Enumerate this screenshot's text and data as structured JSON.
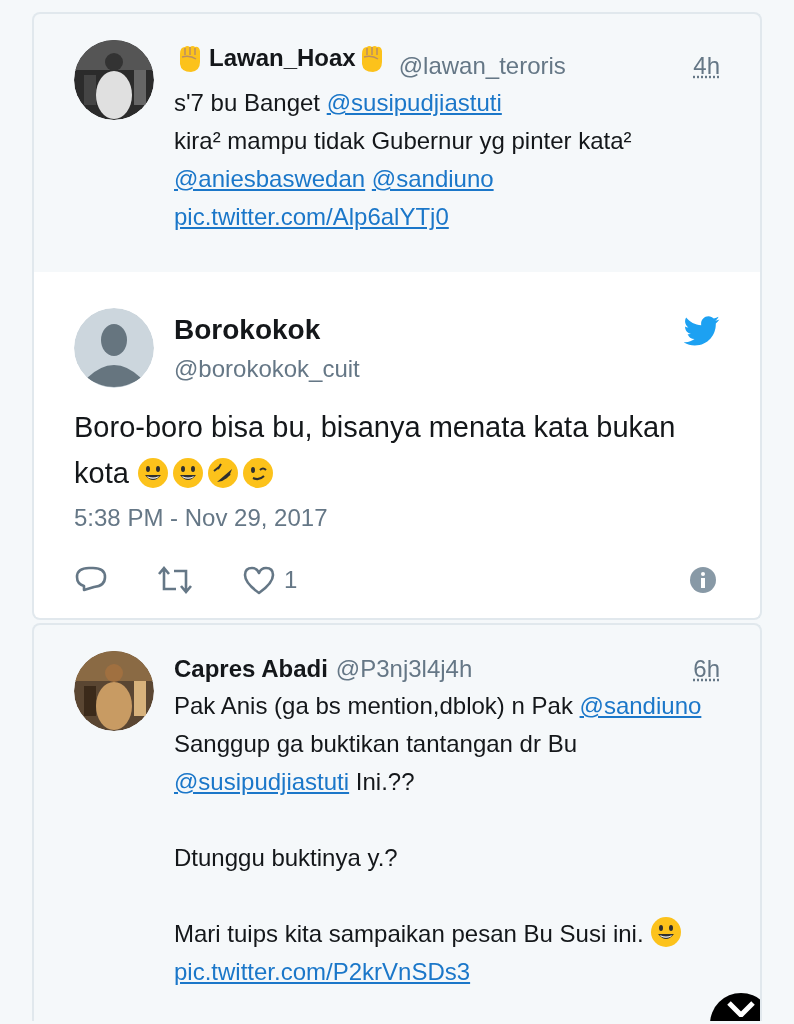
{
  "tweets": [
    {
      "kind": "reply",
      "name_parts": [
        {
          "kind": "fist"
        },
        {
          "kind": "text",
          "text": "Lawan_Hoax"
        },
        {
          "kind": "fist"
        }
      ],
      "handle": "@lawan_teroris",
      "time": "4h",
      "paragraphs": [
        [
          [
            {
              "kind": "text",
              "text": "s'7 bu Banget "
            },
            {
              "kind": "link",
              "text": "@susipudjiastuti"
            }
          ],
          [
            {
              "kind": "text",
              "text": "kira² mampu tidak Gubernur yg pinter kata²"
            }
          ],
          [
            {
              "kind": "link",
              "text": "@aniesbaswedan"
            },
            {
              "kind": "link",
              "text": "@sandiuno"
            }
          ],
          [
            {
              "kind": "link",
              "text": "pic.twitter.com/Alp6alYTj0"
            }
          ]
        ]
      ]
    },
    {
      "kind": "main",
      "name": "Borokokok",
      "handle": "@borokokok_cuit",
      "paragraphs": [
        [
          [
            {
              "kind": "text",
              "text": "Boro-boro bisa bu, bisanya menata kata bukan kota "
            },
            {
              "kind": "smile"
            },
            {
              "kind": "smile"
            },
            {
              "kind": "laugh"
            },
            {
              "kind": "wink"
            }
          ]
        ]
      ],
      "timestamp": "5:38 PM - Nov 29, 2017",
      "like_count": "1"
    },
    {
      "kind": "reply",
      "name_parts": [
        {
          "kind": "text",
          "text": "Capres Abadi"
        }
      ],
      "handle": "@P3nj3l4j4h",
      "time": "6h",
      "paragraphs": [
        [
          [
            {
              "kind": "text",
              "text": "Pak Anis (ga bs mention,dblok) n Pak "
            },
            {
              "kind": "link",
              "text": "@sandiuno"
            },
            {
              "kind": "text",
              "text": " Sanggup ga buktikan tantangan dr Bu "
            },
            {
              "kind": "link",
              "text": "@susipudjiastuti"
            },
            {
              "kind": "text",
              "text": " Ini.??"
            }
          ]
        ],
        [
          [
            {
              "kind": "text",
              "text": "Dtunggu buktinya y.?"
            }
          ]
        ],
        [
          [
            {
              "kind": "text",
              "text": "Mari tuips kita sampaikan pesan Bu Susi ini. "
            },
            {
              "kind": "smile"
            },
            {
              "kind": "link",
              "text": "pic.twitter.com/P2krVnSDs3"
            }
          ]
        ]
      ]
    }
  ]
}
